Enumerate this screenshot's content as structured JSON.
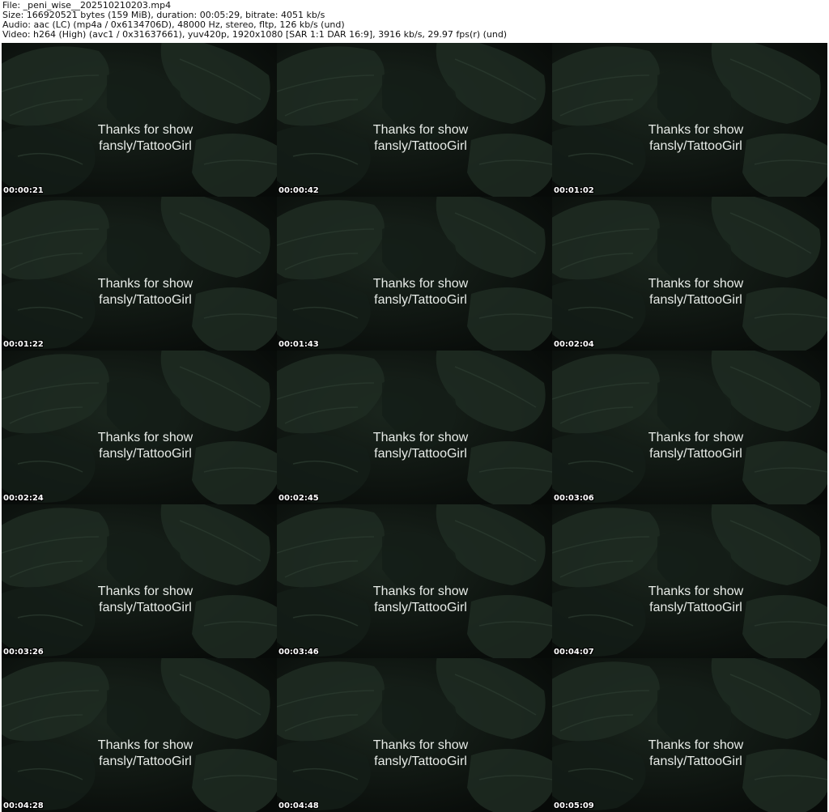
{
  "header": {
    "file": "File: _peni_wise__202510210203.mp4",
    "size": "Size: 166920521 bytes (159 MiB), duration: 00:05:29, bitrate: 4051 kb/s",
    "audio": "Audio: aac (LC) (mp4a / 0x6134706D), 48000 Hz, stereo, fltp, 126 kb/s (und)",
    "video": "Video: h264 (High) (avc1 / 0x31637661), yuv420p, 1920x1080 [SAR 1:1 DAR 16:9], 3916 kb/s, 29.97 fps(r) (und)"
  },
  "caption": {
    "line1": "Thanks for show",
    "line2": "fansly/TattooGirl"
  },
  "colors": {
    "background": "#0b0f0c",
    "leaf": "#1e2b22",
    "leaf_dark": "#141d17",
    "leaf_vein": "#2a3a2e"
  },
  "thumbnails": [
    {
      "timestamp": "00:00:21"
    },
    {
      "timestamp": "00:00:42"
    },
    {
      "timestamp": "00:01:02"
    },
    {
      "timestamp": "00:01:22"
    },
    {
      "timestamp": "00:01:43"
    },
    {
      "timestamp": "00:02:04"
    },
    {
      "timestamp": "00:02:24"
    },
    {
      "timestamp": "00:02:45"
    },
    {
      "timestamp": "00:03:06"
    },
    {
      "timestamp": "00:03:26"
    },
    {
      "timestamp": "00:03:46"
    },
    {
      "timestamp": "00:04:07"
    },
    {
      "timestamp": "00:04:28"
    },
    {
      "timestamp": "00:04:48"
    },
    {
      "timestamp": "00:05:09"
    }
  ]
}
